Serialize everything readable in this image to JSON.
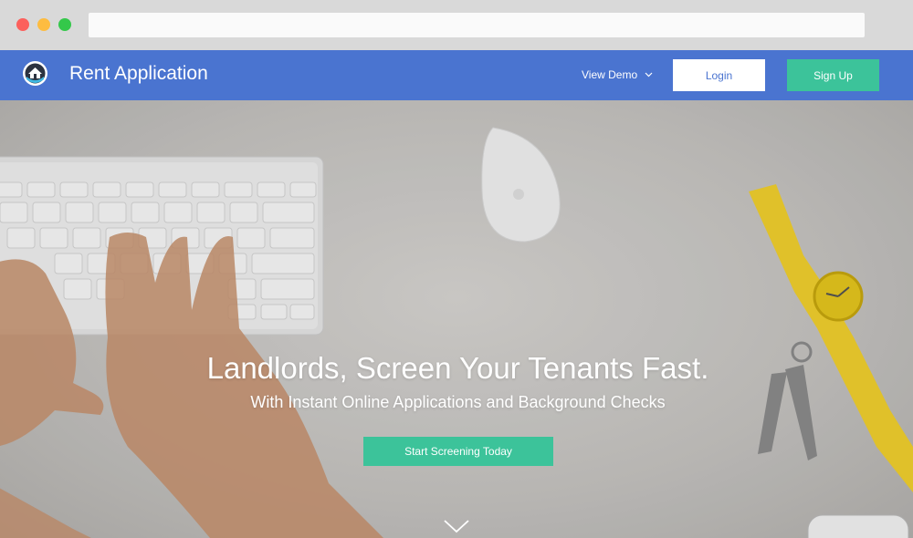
{
  "browser": {
    "url": ""
  },
  "nav": {
    "brand": "Rent Application",
    "view_demo": "View Demo",
    "login": "Login",
    "signup": "Sign Up",
    "bg_color": "#4a74d0"
  },
  "hero": {
    "headline": "Landlords, Screen Your Tenants Fast.",
    "subheadline": "With Instant Online Applications and Background Checks",
    "cta": "Start Screening Today",
    "cta_color": "#3cc39a",
    "scroll_icon": "chevron-down-icon"
  }
}
